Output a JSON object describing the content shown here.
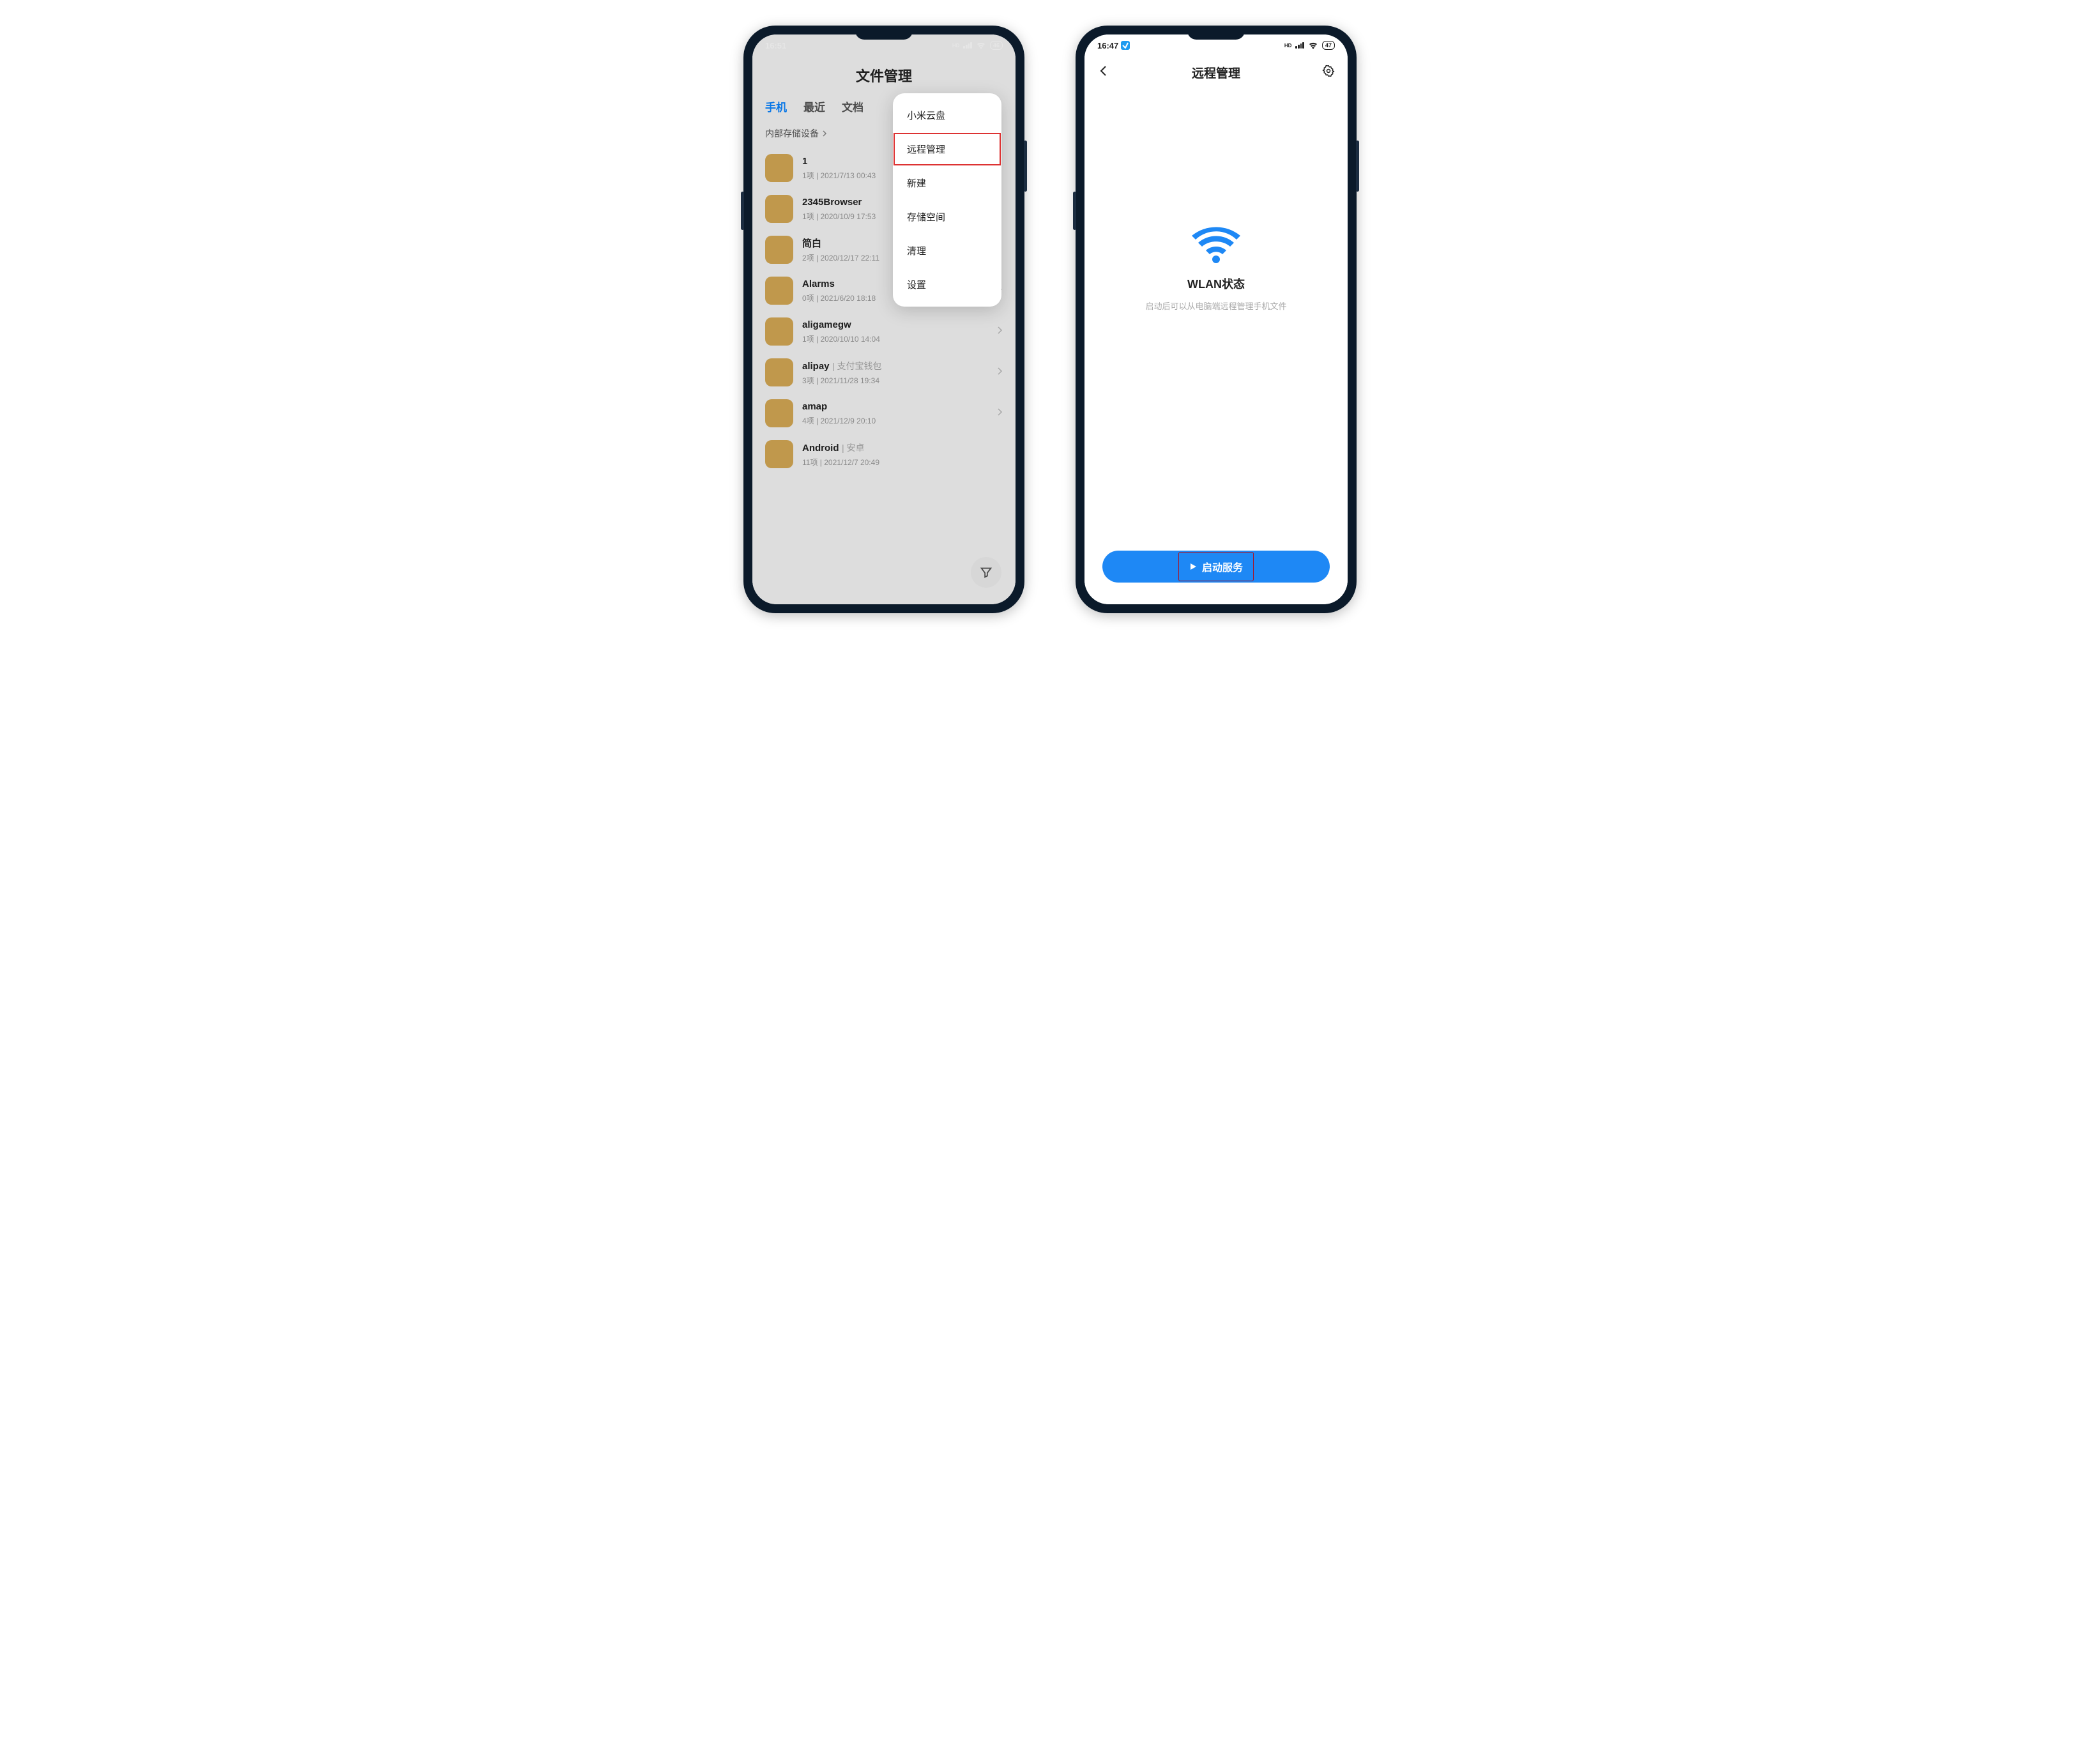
{
  "left": {
    "status": {
      "time": "16:51",
      "hd": "HD",
      "battery": "46"
    },
    "title": "文件管理",
    "tabs": {
      "t0": "手机",
      "t1": "最近",
      "t2": "文档"
    },
    "crumb": "内部存储设备",
    "menu": {
      "m0": "小米云盘",
      "m1": "远程管理",
      "m2": "新建",
      "m3": "存储空间",
      "m4": "清理",
      "m5": "设置"
    },
    "files": {
      "f0": {
        "name": "1",
        "meta": "1项  |  2021/7/13 00:43"
      },
      "f1": {
        "name": "2345Browser",
        "meta": "1项  |  2020/10/9 17:53"
      },
      "f2": {
        "name": "简白",
        "meta": "2项  |  2020/12/17 22:11"
      },
      "f3": {
        "name": "Alarms",
        "meta": "0项  |  2021/6/20 18:18"
      },
      "f4": {
        "name": "aligamegw",
        "meta": "1项  |  2020/10/10 14:04"
      },
      "f5": {
        "name": "alipay",
        "tag": "支付宝钱包",
        "meta": "3项  |  2021/11/28 19:34"
      },
      "f6": {
        "name": "amap",
        "meta": "4项  |  2021/12/9 20:10"
      },
      "f7": {
        "name": "Android",
        "tag": "安卓",
        "meta": "11项  |  2021/12/7 20:49"
      }
    }
  },
  "right": {
    "status": {
      "time": "16:47",
      "hd": "HD",
      "battery": "47"
    },
    "title": "远程管理",
    "wlan_title": "WLAN状态",
    "wlan_sub": "启动后可以从电脑端远程管理手机文件",
    "cta": "启动服务"
  }
}
